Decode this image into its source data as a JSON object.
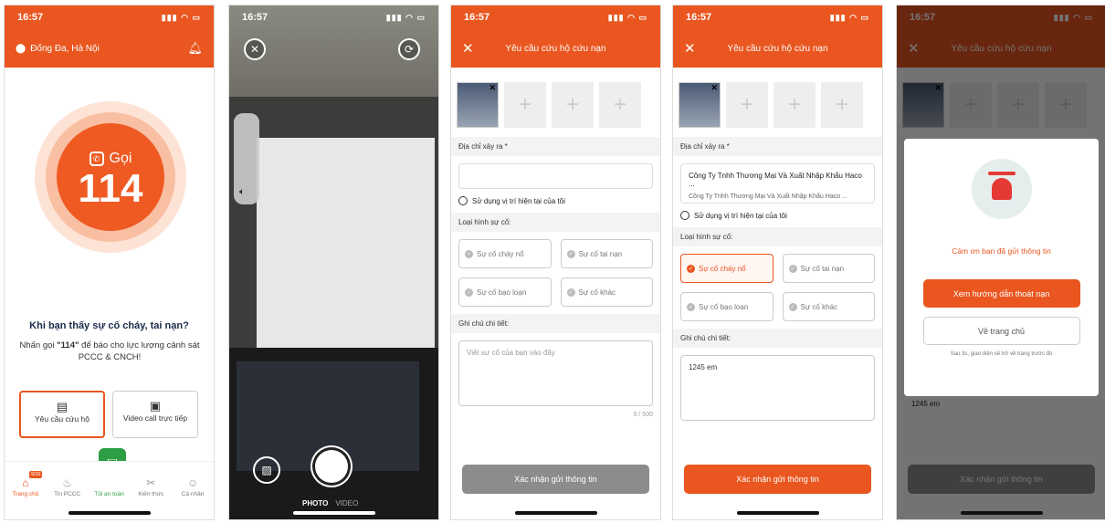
{
  "status_time": "16:57",
  "status_icons": "▮▮▮ ◠ ▭",
  "home": {
    "location": "Đống Đa, Hà Nội",
    "call_label": "Gọi",
    "call_number": "114",
    "question": "Khi bạn thấy sự cố cháy, tai nạn?",
    "desc_prefix": "Nhấn gọi ",
    "desc_number": "\"114\"",
    "desc_suffix": " để báo cho lực lượng cảnh sát PCCC & CNCH!",
    "option_rescue": "Yêu cầu cứu hộ",
    "option_video": "Video call trực tiếp",
    "tabs": [
      "Trang chủ",
      "Tin PCCC",
      "Tôi an toàn",
      "Kiến thức",
      "Cá nhân"
    ],
    "sos_badge": "SOS"
  },
  "camera": {
    "time": "16:57",
    "mode_photo": "PHOTO",
    "mode_video": "VIDEO"
  },
  "form": {
    "title": "Yêu cầu cứu hộ cứu nạn",
    "address_label": "Địa chỉ xảy ra *",
    "use_location": "Sử dụng vị trí hiện tại của tôi",
    "type_label": "Loại hình sự cố:",
    "types": [
      "Sự cố cháy nổ",
      "Sự cố tai nạn",
      "Sự cố bạo loạn",
      "Sự cố khác"
    ],
    "note_label": "Ghi chú chi tiết:",
    "note_placeholder": "Viết sự cố của bạn vào đây",
    "counter": "0 / 500",
    "submit": "Xác nhận gửi thông tin"
  },
  "form_filled": {
    "address_line1": "Công Ty Tnhh Thương Mại Và Xuất Nhập Khẩu Haco ...",
    "address_line2": "Công Ty Tnhh Thương Mại Và Xuất Nhập Khẩu Haco ...",
    "note_value": "1245 em",
    "colors": {
      "accent": "#e9561f",
      "disabled": "#8c8c8c"
    }
  },
  "modal": {
    "thanks": "Cảm ơn bạn đã gửi thông tin",
    "primary": "Xem hướng dẫn thoát nạn",
    "secondary": "Về trang chủ",
    "note": "Sau 3s, giao diện sẽ trở về trang trước đó"
  }
}
